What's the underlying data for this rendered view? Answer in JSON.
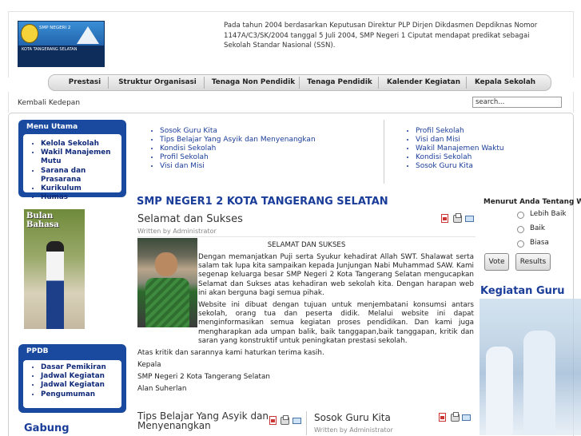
{
  "header": {
    "intro": "Pada tahun 2004 berdasarkan Keputusan Direktur PLP Dirjen Dikdasmen Depdiknas Nomor 1147A/C3/SK/2004 tanggal 5 Juli 2004, SMP Negeri 1 Ciputat mendapat predikat sebagai Sekolah Standar Nasional (SSN).",
    "logo_text_top": "SMP NEGERI 2",
    "logo_text_bottom": "KOTA TANGERANG SELATAN"
  },
  "nav": {
    "items": [
      "Prestasi",
      "Struktur Organisasi",
      "Tenaga Non Pendidik",
      "Tenaga Pendidik",
      "Kalender Kegiatan",
      "Kepala Sekolah"
    ]
  },
  "subbar": {
    "back": "Kembali Kedepan",
    "search_value": "search..."
  },
  "menu_utama": {
    "title": "Menu Utama",
    "items": [
      "Kelola Sekolah",
      "Wakil Manajemen Mutu",
      "Sarana dan Prasarana",
      "Kurikulum",
      "Humas"
    ]
  },
  "banner": {
    "text": "Bulan Bahasa"
  },
  "ppdb": {
    "title": "PPDB",
    "items": [
      "Dasar Pemikiran",
      "Jadwal Kegiatan",
      "Jadwal Kegiatan",
      "Pengumuman"
    ]
  },
  "gabung": "Gabung",
  "top_links_left": [
    "Sosok Guru Kita",
    "Tips Belajar Yang Asyik dan Menyenangkan",
    "Kondisi Sekolah",
    "Profil Sekolah",
    "Visi dan Misi"
  ],
  "top_links_right": [
    "Profil Sekolah",
    "Visi dan Misi",
    "Wakil Manajemen Waktu",
    "Kondisi Sekolah",
    "Sosok Guru Kita"
  ],
  "main": {
    "component_title": "SMP NEGER1 2 KOTA TANGERANG SELATAN",
    "article_title": "Selamat dan Sukses",
    "written_by": "Written by Administrator",
    "heading": "SELAMAT DAN SUKSES",
    "p1": "Dengan memanjatkan Puji serta Syukur kehadirat Allah SWT. Shalawat serta salam tak lupa kita sampaikan kepada Junjungan Nabi Muhammad SAW. Kami segenap keluarga besar SMP Negeri 2 Kota Tangerang Selatan mengucapkan Selamat dan Sukses atas kehadiran web sekolah kita. Dengan harapan web ini akan berguna bagi semua pihak.",
    "p2": "Website ini dibuat dengan tujuan untuk menjembatani konsumsi antars sekolah, orang tua dan peserta didik. Melalui website ini dapat menginformasikan semua kegiatan proses pendidikan. Dan kami juga mengharapkan ada umpan balik, baik tanggapan,baik tanggapan, kritik dan saran yang konstruktif untuk peningkatan prestasi sekolah.",
    "line1": "Atas kritik dan sarannya kami haturkan terima kasih.",
    "line2": "Kepala",
    "line3": "SMP Negeri 2 Kota Tangerang Selatan",
    "line4": "Alan Suherlan"
  },
  "poll": {
    "title": "Menurut Anda Tentang Web ini",
    "options": [
      "Lebih Baik",
      "Baik",
      "Biasa"
    ],
    "vote": "Vote",
    "results": "Results"
  },
  "kegiatan_guru": "Kegiatan Guru",
  "bottom": {
    "left_title": "Tips Belajar Yang Asyik dan Menyenangkan",
    "right_title": "Sosok Guru Kita",
    "right_written": "Written by Administrator"
  }
}
